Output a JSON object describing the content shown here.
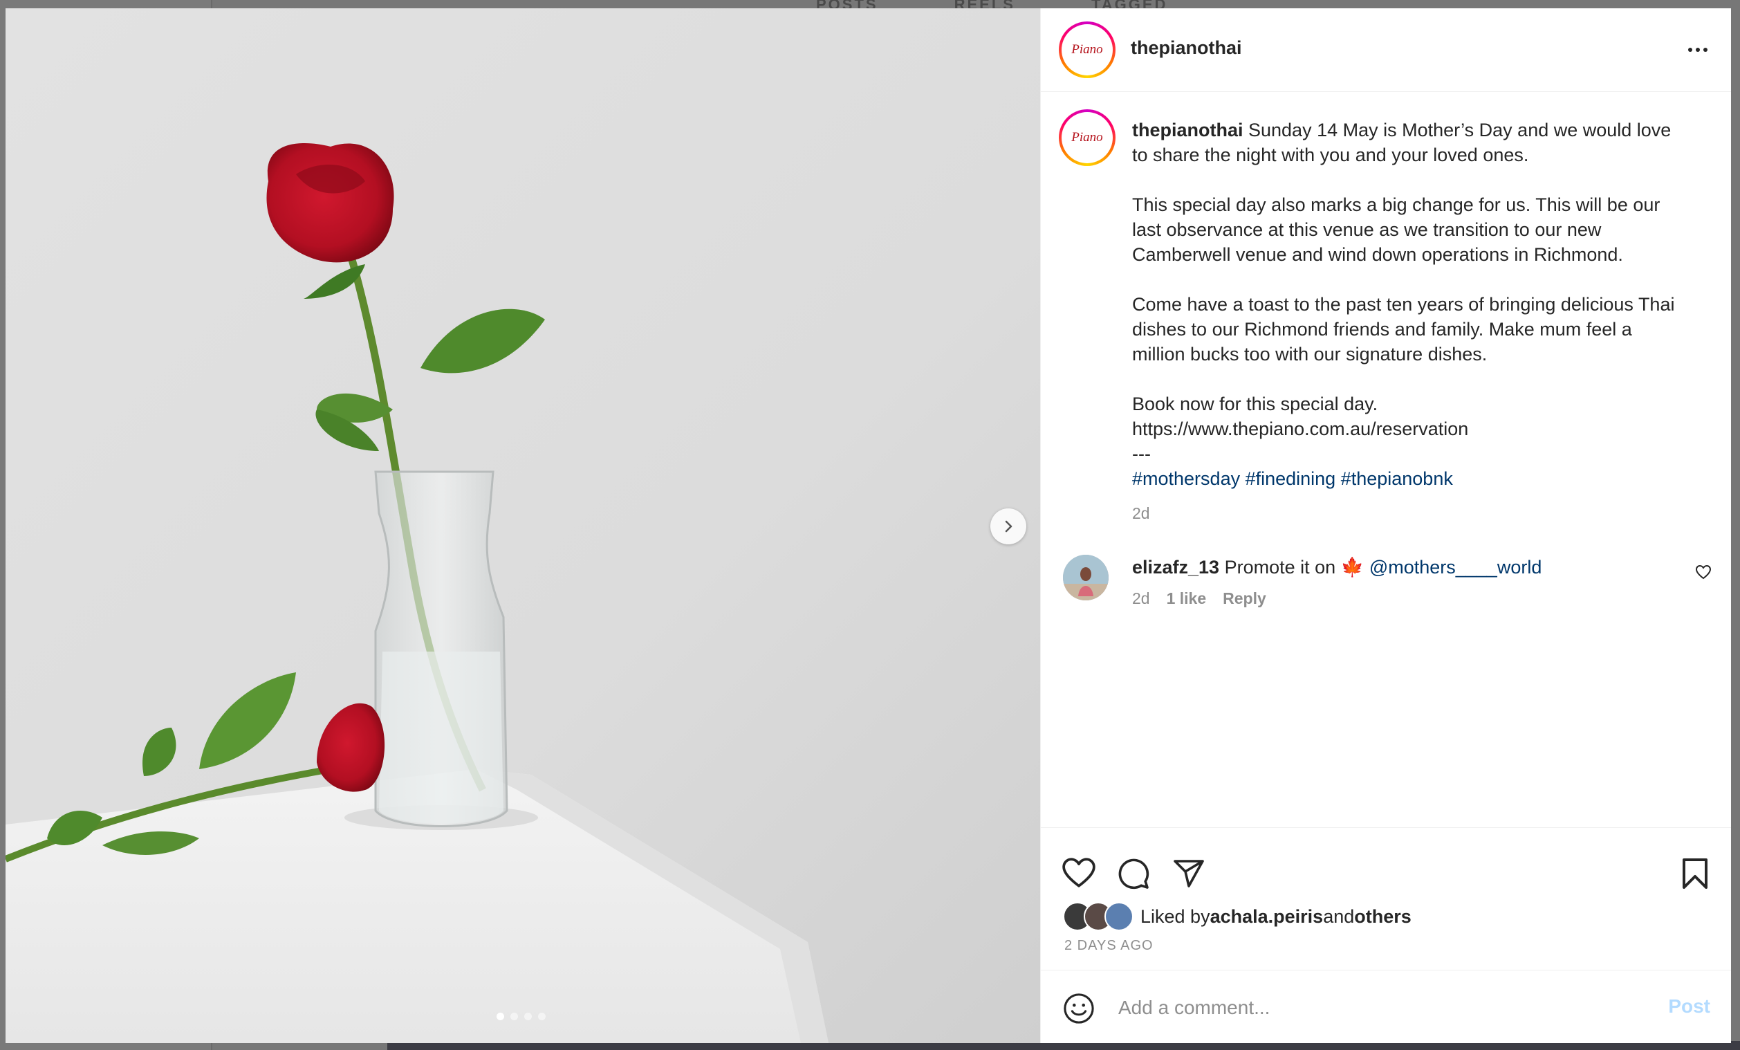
{
  "background": {
    "tabs": [
      "POSTS",
      "REELS",
      "TAGGED"
    ]
  },
  "post": {
    "username": "thepianothai",
    "avatar_text": "Piano",
    "caption": {
      "username": "thepianothai",
      "text": " Sunday 14 May is Mother’s Day and we would love to share the night with you and your loved ones.\n\nThis special day also marks a big change for us. This will be our last observance at this venue as we transition to our new Camberwell venue and wind down operations in Richmond.\n\nCome have a toast to the past ten years of bringing delicious Thai dishes to our Richmond friends and family. Make mum feel a million bucks too with our signature dishes.\n\nBook now for this special day.\nhttps://www.thepiano.com.au/reservation\n---",
      "hashtags": "#mothersday #finedining #thepianobnk",
      "time": "2d"
    },
    "carousel": {
      "slides": 4,
      "active": 1
    },
    "comments": [
      {
        "username": "elizafz_13",
        "text": " Promote it on ",
        "emoji": "🍁",
        "mention": "@mothers____world",
        "time": "2d",
        "likes": "1 like",
        "reply": "Reply"
      }
    ],
    "likes": {
      "prefix": "Liked by ",
      "user": "achala.peiris",
      "middle": " and ",
      "others": "others"
    },
    "date": "2 DAYS AGO",
    "add_comment": {
      "placeholder": "Add a comment...",
      "post_label": "Post"
    }
  },
  "icons": {
    "more": "more-options-icon",
    "like": "heart-icon",
    "comment": "comment-icon",
    "share": "paper-plane-icon",
    "save": "bookmark-icon",
    "emoji": "smiley-icon",
    "next": "chevron-right-icon"
  }
}
